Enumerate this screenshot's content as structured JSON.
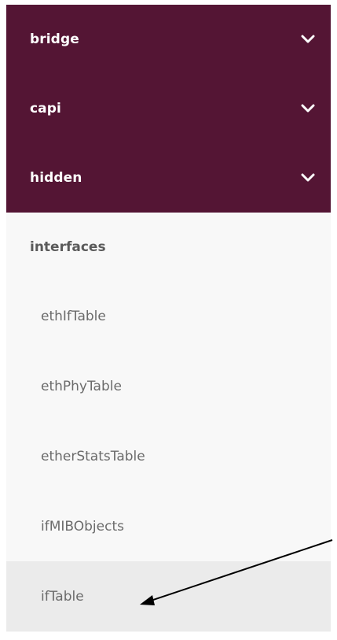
{
  "groups": [
    {
      "label": "bridge"
    },
    {
      "label": "capi"
    },
    {
      "label": "hidden"
    }
  ],
  "section": {
    "label": "interfaces"
  },
  "items": [
    {
      "label": "ethIfTable"
    },
    {
      "label": "ethPhyTable"
    },
    {
      "label": "etherStatsTable"
    },
    {
      "label": "ifMIBObjects"
    },
    {
      "label": "ifTable",
      "selected": true
    }
  ],
  "icons": {
    "expand": "chevron-down-icon",
    "annotation": "arrow-annotation"
  },
  "colors": {
    "group_bg": "#541534",
    "group_text": "#ffffff",
    "list_bg": "#f8f8f8",
    "selected_bg": "#ebebeb",
    "item_text": "#6b6b6b",
    "section_text": "#5a5a5a"
  }
}
